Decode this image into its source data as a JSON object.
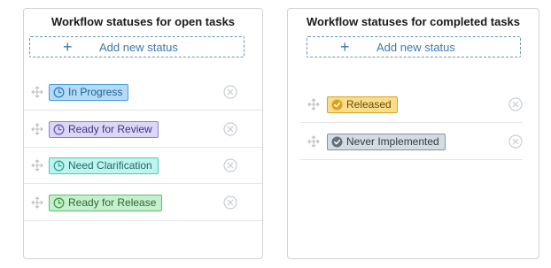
{
  "open_panel": {
    "title": "Workflow statuses for open tasks",
    "add_label": "Add new status",
    "statuses": [
      {
        "label": "In Progress",
        "icon": "clock-icon",
        "bg": "#b3dbf6",
        "border": "#4a9fd6",
        "text": "#1f5f8f",
        "icon_color": "#2f7fbf"
      },
      {
        "label": "Ready for Review",
        "icon": "clock-icon",
        "bg": "#dcd6f7",
        "border": "#8d7fd1",
        "text": "#3e3580",
        "icon_color": "#6a5bbf"
      },
      {
        "label": "Need Clarification",
        "icon": "clock-icon",
        "bg": "#bff3ee",
        "border": "#4dc8bd",
        "text": "#1e6d66",
        "icon_color": "#2aa79c"
      },
      {
        "label": "Ready for Release",
        "icon": "clock-icon",
        "bg": "#c6efcd",
        "border": "#5ebd6d",
        "text": "#2b6a36",
        "icon_color": "#3f9a4f"
      }
    ]
  },
  "completed_panel": {
    "title": "Workflow statuses for completed tasks",
    "add_label": "Add new status",
    "statuses": [
      {
        "label": "Released",
        "icon": "check-circle-icon",
        "bg": "#f9dd8a",
        "border": "#d2a326",
        "text": "#6b4e00",
        "icon_color": "#e0a11a"
      },
      {
        "label": "Never Implemented",
        "icon": "check-circle-icon",
        "bg": "#d5dbe2",
        "border": "#8793a0",
        "text": "#2f3a45",
        "icon_color": "#66717d"
      }
    ]
  }
}
